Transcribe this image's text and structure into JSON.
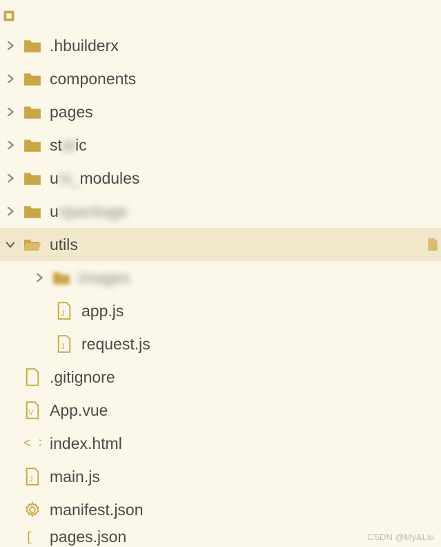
{
  "root": {
    "label": ""
  },
  "items": [
    {
      "label": ".hbuilderx",
      "type": "folder",
      "depth": 1,
      "chev": "right"
    },
    {
      "label": "components",
      "type": "folder",
      "depth": 1,
      "chev": "right"
    },
    {
      "label": "pages",
      "type": "folder",
      "depth": 1,
      "chev": "right"
    },
    {
      "label": "static",
      "type": "folder",
      "depth": 1,
      "chev": "right",
      "blurtext": true
    },
    {
      "label": "uni_modules",
      "type": "folder",
      "depth": 1,
      "chev": "right",
      "blurtext": true
    },
    {
      "label": "unpackage",
      "type": "folder",
      "depth": 1,
      "chev": "right",
      "blurtext": true
    },
    {
      "label": "utils",
      "type": "folder-open",
      "depth": 1,
      "chev": "down",
      "selected": true
    },
    {
      "label": "images",
      "type": "folder",
      "depth": 2,
      "chev": "right",
      "bluricon": true,
      "blurtext": true
    },
    {
      "label": "app.js",
      "type": "js",
      "depth": 3,
      "chev": "none"
    },
    {
      "label": "request.js",
      "type": "js",
      "depth": 3,
      "chev": "none"
    },
    {
      "label": ".gitignore",
      "type": "file",
      "depth": 1,
      "chev": "none-l"
    },
    {
      "label": "App.vue",
      "type": "vue",
      "depth": 1,
      "chev": "none-l"
    },
    {
      "label": "index.html",
      "type": "html",
      "depth": 1,
      "chev": "none-l"
    },
    {
      "label": "main.js",
      "type": "js",
      "depth": 1,
      "chev": "none-l"
    },
    {
      "label": "manifest.json",
      "type": "gear",
      "depth": 1,
      "chev": "none-l"
    },
    {
      "label": "pages.json",
      "type": "bracket",
      "depth": 1,
      "chev": "none-l"
    }
  ],
  "watermark": "CSDN @My&Liu"
}
